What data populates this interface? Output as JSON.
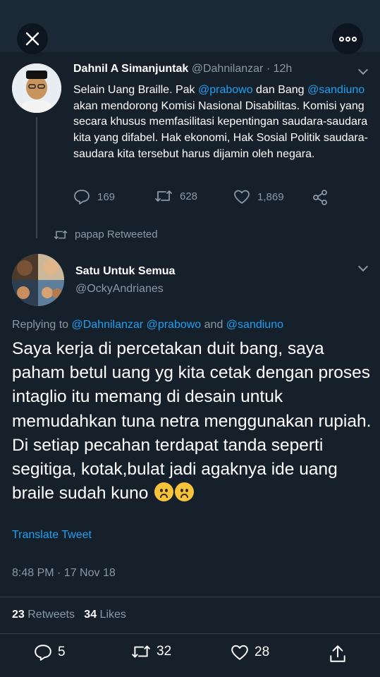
{
  "header": {
    "close_icon": "close-icon",
    "more_icon": "more-horizontal-icon"
  },
  "tweet1": {
    "name": "Dahnil A Simanjuntak",
    "handle": "@Dahnilanzar",
    "separator": "·",
    "time": "12h",
    "text_part1": "Selain Uang Braille. Pak ",
    "mention1": "@prabowo",
    "text_part2": " dan Bang ",
    "mention2": "@sandiuno",
    "text_part3": " akan mendorong Komisi Nasional Disabilitas. Komisi yang secara khusus memfasilitasi kepentingan saudara-saudara kita yang difabel. Hak ekonomi, Hak Sosial Politik  saudara-saudara kita tersebut harus dijamin oleh negara.",
    "reply_count": "169",
    "retweet_count": "628",
    "like_count": "1,869"
  },
  "retweeted_by": "papap Retweeted",
  "tweet2": {
    "name": "Satu Untuk Semua",
    "handle": "@OckyAndrianes",
    "replying_prefix": "Replying to ",
    "replying_to1": "@Dahnilanzar",
    "replying_to2": "@prabowo",
    "replying_and": " and ",
    "replying_to3": "@sandiuno",
    "body": "Saya kerja di percetakan duit bang, saya paham betul uang yg kita cetak dengan proses intaglio itu memang di desain untuk memudahkan tuna netra menggunakan rupiah. Di setiap pecahan terdapat tanda seperti segitiga, kotak,bulat jadi agaknya ide uang braile sudah kuno",
    "translate": "Translate Tweet",
    "timestamp": "8:48 PM · 17 Nov 18",
    "retweets_num": "23",
    "retweets_label": "Retweets",
    "likes_num": "34",
    "likes_label": "Likes",
    "reply_count": "5",
    "retweet_count": "32",
    "like_count": "28"
  },
  "colors": {
    "background": "#15202b",
    "accent": "#1da1f2",
    "muted": "#8899a6",
    "divider": "#38444d"
  }
}
